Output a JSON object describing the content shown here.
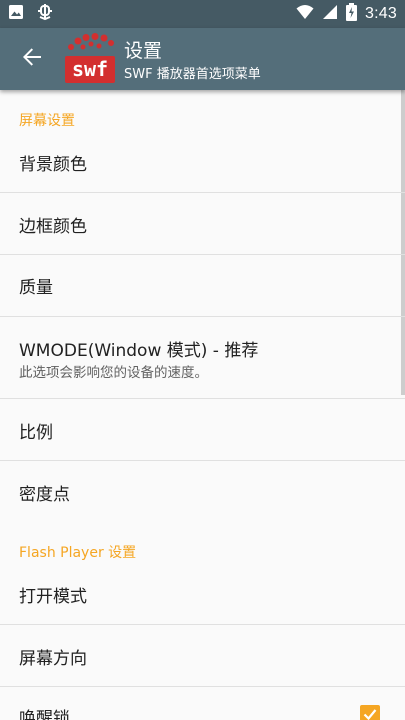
{
  "status_bar": {
    "time": "3:43",
    "left_icons": [
      "image-icon",
      "bug-icon"
    ],
    "right_icons": [
      "wifi-icon",
      "cell-signal-icon",
      "battery-charging-icon"
    ]
  },
  "toolbar": {
    "title": "设置",
    "subtitle": "SWF 播放器首选项菜单",
    "logo_text": "swf",
    "back_icon": "arrow-back-icon"
  },
  "sections": [
    {
      "category": "屏幕设置",
      "items": [
        {
          "title": "背景颜色"
        },
        {
          "title": "边框颜色"
        },
        {
          "title": "质量"
        },
        {
          "title": "WMODE(Window 模式) - 推荐",
          "summary": "此选项会影响您的设备的速度。"
        },
        {
          "title": "比例"
        },
        {
          "title": "密度点"
        }
      ]
    },
    {
      "category": "Flash Player 设置",
      "items": [
        {
          "title": "打开模式"
        },
        {
          "title": "屏幕方向"
        },
        {
          "title": "唤醒锁",
          "checked": true
        }
      ]
    }
  ],
  "colors": {
    "status_bar": "#455a64",
    "toolbar": "#546e7a",
    "accent": "#f5a623",
    "logo_red": "#d32f2f"
  }
}
